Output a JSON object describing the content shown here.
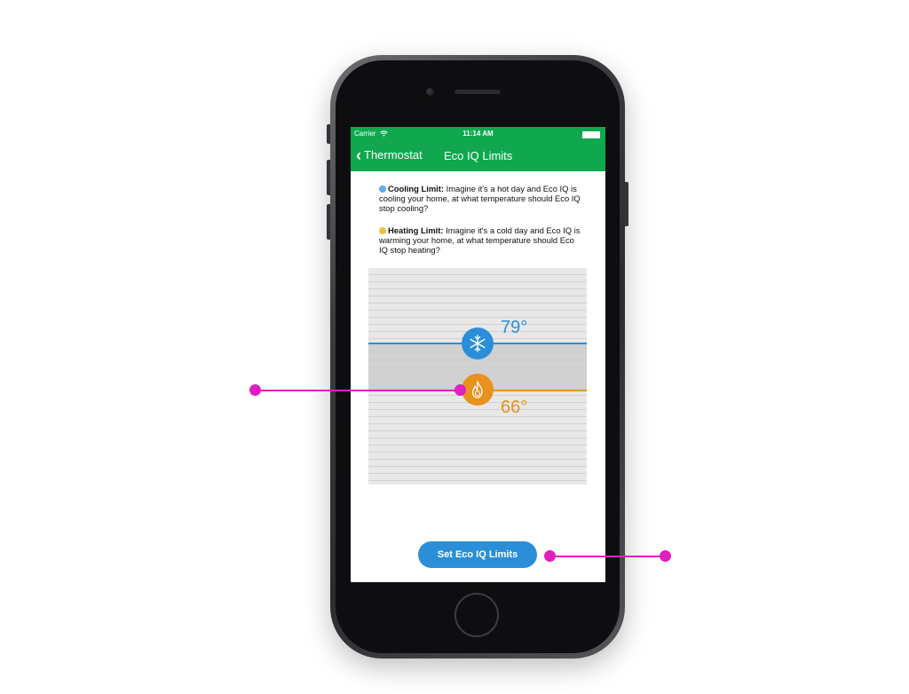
{
  "status_bar": {
    "carrier": "Carrier",
    "time": "11:14 AM"
  },
  "nav": {
    "back_label": "Thermostat",
    "title": "Eco IQ Limits"
  },
  "info": {
    "cooling": {
      "title": "Cooling Limit:",
      "text": "Imagine it's a hot day and Eco IQ is cooling your home, at what temperature should Eco IQ stop cooling?"
    },
    "heating": {
      "title": "Heating Limit:",
      "text": "Imagine it's a cold day and Eco IQ is warming your home, at what temperature should Eco IQ stop heating?"
    }
  },
  "slider": {
    "cooling_temp": "79°",
    "heating_temp": "66°"
  },
  "cta": {
    "label": "Set Eco IQ Limits"
  },
  "colors": {
    "nav_green": "#10a84e",
    "cool_blue": "#2a8fd8",
    "heat_orange": "#e8911c",
    "callout_magenta": "#e020c0"
  },
  "icons": {
    "cooling": "snowflake-icon",
    "heating": "flame-icon",
    "back": "chevron-left-icon",
    "wifi": "wifi-icon",
    "battery": "battery-icon"
  }
}
